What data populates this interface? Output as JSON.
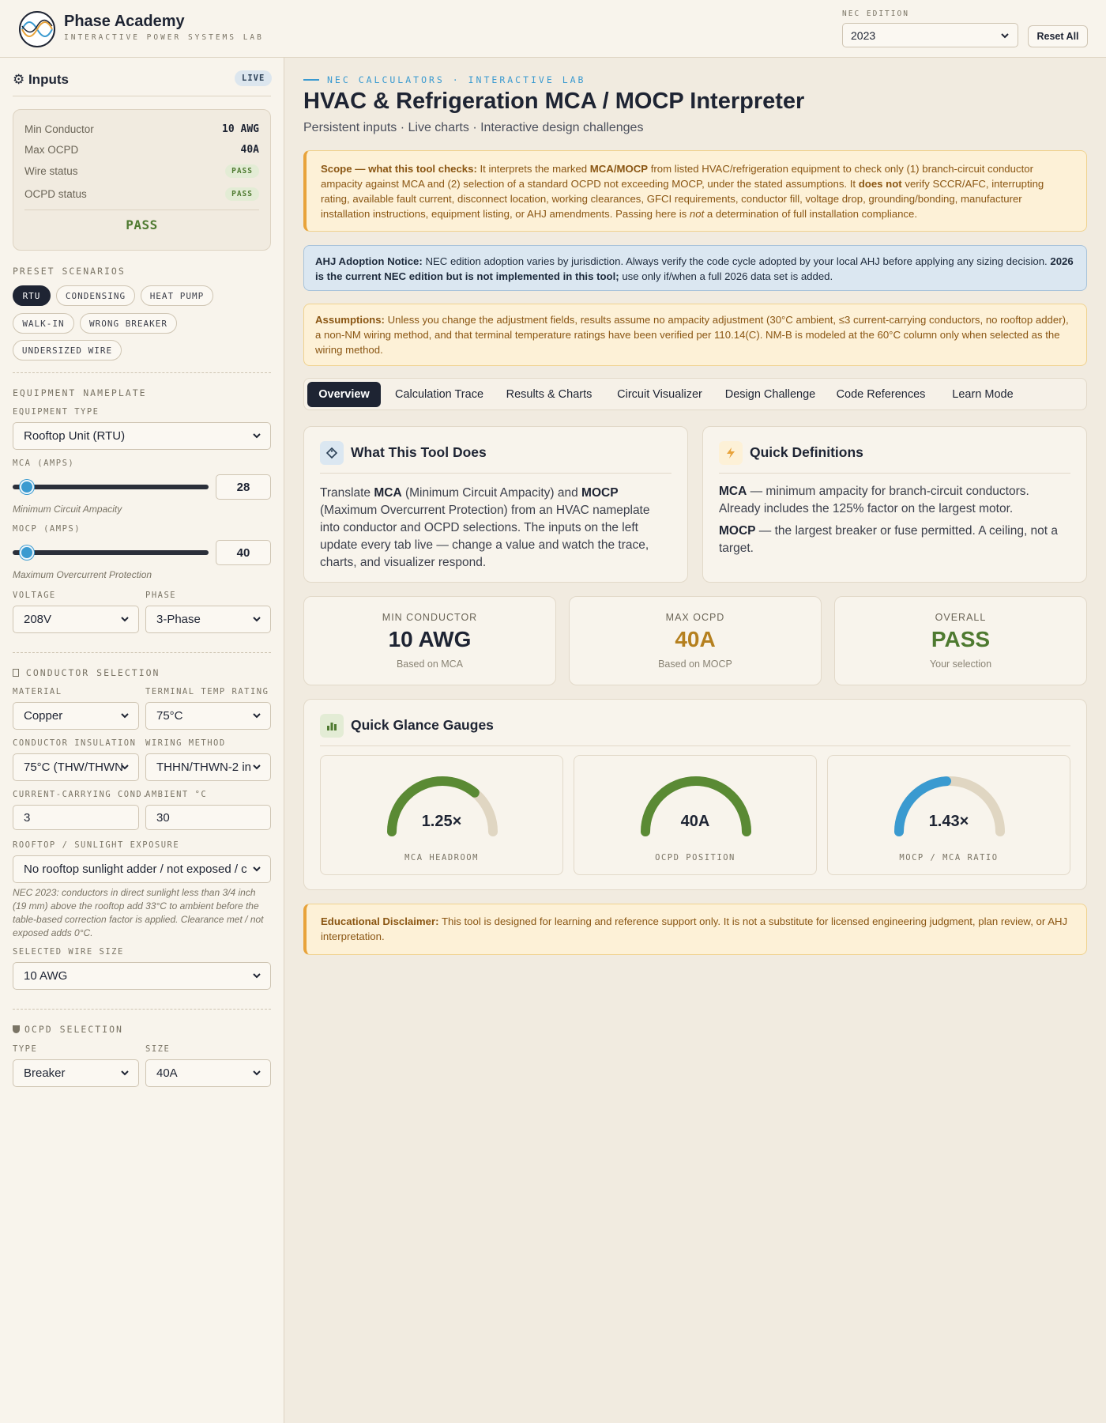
{
  "header": {
    "brand_title": "Phase Academy",
    "brand_subtitle": "INTERACTIVE POWER SYSTEMS LAB",
    "edition_label": "NEC EDITION",
    "edition_value": "2023",
    "reset_label": "Reset All"
  },
  "sidebar": {
    "title": "⚙ Inputs",
    "live_badge": "LIVE",
    "summary": {
      "min_conductor_label": "Min Conductor",
      "min_conductor_value": "10 AWG",
      "max_ocpd_label": "Max OCPD",
      "max_ocpd_value": "40A",
      "wire_status_label": "Wire status",
      "wire_status_value": "PASS",
      "ocpd_status_label": "OCPD status",
      "ocpd_status_value": "PASS",
      "overall": "PASS"
    },
    "presets_label": "PRESET SCENARIOS",
    "presets": [
      "RTU",
      "CONDENSING",
      "HEAT PUMP",
      "WALK-IN",
      "WRONG BREAKER",
      "UNDERSIZED WIRE"
    ],
    "nameplate": {
      "section_label": "EQUIPMENT NAMEPLATE",
      "equipment_type_label": "EQUIPMENT TYPE",
      "equipment_type_value": "Rooftop Unit (RTU)",
      "mca_label": "MCA (AMPS)",
      "mca_value": "28",
      "mca_slider_fraction": 0.04,
      "mca_hint": "Minimum Circuit Ampacity",
      "mocp_label": "MOCP (AMPS)",
      "mocp_value": "40",
      "mocp_slider_fraction": 0.04,
      "mocp_hint": "Maximum Overcurrent Protection",
      "voltage_label": "VOLTAGE",
      "voltage_value": "208V",
      "phase_label": "PHASE",
      "phase_value": "3-Phase"
    },
    "conductor": {
      "section_label": " CONDUCTOR SELECTION",
      "material_label": "MATERIAL",
      "material_value": "Copper",
      "terminal_label": "TERMINAL TEMP RATING",
      "terminal_value": "75°C",
      "insulation_label": "CONDUCTOR INSULATION",
      "insulation_value": "75°C (THW/THWN",
      "wiring_label": "WIRING METHOD",
      "wiring_value": "THHN/THWN-2 in",
      "ccc_label": "CURRENT-CARRYING COND.",
      "ccc_value": "3",
      "ambient_label": "AMBIENT °C",
      "ambient_value": "30",
      "rooftop_label": "ROOFTOP / SUNLIGHT EXPOSURE",
      "rooftop_value": "No rooftop sunlight adder / not exposed / c",
      "rooftop_hint": "NEC 2023: conductors in direct sunlight less than 3/4 inch (19 mm) above the rooftop add 33°C to ambient before the table-based correction factor is applied. Clearance met / not exposed adds 0°C.",
      "wire_size_label": "SELECTED WIRE SIZE",
      "wire_size_value": "10 AWG"
    },
    "ocpd": {
      "section_label": "OCPD SELECTION",
      "type_label": "TYPE",
      "type_value": "Breaker",
      "size_label": "SIZE",
      "size_value": "40A"
    }
  },
  "main": {
    "eyebrow": "NEC CALCULATORS · INTERACTIVE LAB",
    "title": "HVAC & Refrigeration MCA / MOCP Interpreter",
    "subtitle": "Persistent inputs · Live charts · Interactive design challenges",
    "scope": {
      "lead": "Scope — what this tool checks:",
      "t1": " It interprets the marked ",
      "b1": "MCA/MOCP",
      "t2": " from listed HVAC/refrigeration equipment to check only (1) branch-circuit conductor ampacity against MCA and (2) selection of a standard OCPD not exceeding MOCP, under the stated assumptions. It ",
      "b2": "does not",
      "t3": " verify SCCR/AFC, interrupting rating, available fault current, disconnect location, working clearances, GFCI requirements, conductor fill, voltage drop, grounding/bonding, manufacturer installation instructions, equipment listing, or AHJ amendments. Passing here is ",
      "i1": "not",
      "t4": " a determination of full installation compliance."
    },
    "ahj": {
      "lead": "AHJ Adoption Notice:",
      "t1": " NEC edition adoption varies by jurisdiction. Always verify the code cycle adopted by your local AHJ before applying any sizing decision. ",
      "b1": "2026 is the current NEC edition but is not implemented in this tool;",
      "t2": " use only if/when a full 2026 data set is added."
    },
    "assumptions": {
      "lead": "Assumptions:",
      "text": " Unless you change the adjustment fields, results assume no ampacity adjustment (30°C ambient, ≤3 current-carrying conductors, no rooftop adder), a non-NM wiring method, and that terminal temperature ratings have been verified per 110.14(C). NM-B is modeled at the 60°C column only when selected as the wiring method."
    },
    "tabs": [
      "Overview",
      "Calculation Trace",
      "Results & Charts",
      "Circuit Visualizer",
      "Design Challenge",
      "Code References",
      "Learn Mode"
    ],
    "what_card": {
      "title": "What This Tool Does",
      "t1": "Translate ",
      "b1": "MCA",
      "t2": " (Minimum Circuit Ampacity) and ",
      "b2": "MOCP",
      "t3": " (Maximum Overcurrent Protection) from an HVAC nameplate into conductor and OCPD selections. The inputs on the left update every tab live — change a value and watch the trace, charts, and visualizer respond."
    },
    "defs_card": {
      "title": "Quick Definitions",
      "mca_term": "MCA",
      "mca_def": " — minimum ampacity for branch-circuit conductors. Already includes the 125% factor on the largest motor.",
      "mocp_term": "MOCP",
      "mocp_def": " — the largest breaker or fuse permitted. A ceiling, not a target."
    },
    "stats": [
      {
        "label": "MIN CONDUCTOR",
        "value": "10 AWG",
        "sub": "Based on MCA"
      },
      {
        "label": "MAX OCPD",
        "value": "40A",
        "sub": "Based on MOCP"
      },
      {
        "label": "OVERALL",
        "value": "PASS",
        "sub": "Your selection"
      }
    ],
    "gauges_card": {
      "title": "Quick Glance Gauges",
      "gauges": [
        {
          "value": "1.25×",
          "label": "MCA HEADROOM",
          "fraction": 0.72,
          "color": "#5a8a34"
        },
        {
          "value": "40A",
          "label": "OCPD POSITION",
          "fraction": 1.0,
          "color": "#5a8a34"
        },
        {
          "value": "1.43×",
          "label": "MOCP / MCA RATIO",
          "fraction": 0.48,
          "color": "#3a9ad0"
        }
      ]
    },
    "disclaimer": {
      "lead": "Educational Disclaimer:",
      "text": " This tool is designed for learning and reference support only. It is not a substitute for licensed engineering judgment, plan review, or AHJ interpretation."
    }
  },
  "colors": {
    "navy": "#1e2433",
    "accent_blue": "#3a9ad0",
    "pass_green": "#4e7a30",
    "ocpd_gold": "#b5801f",
    "gauge_track": "#e0d6c2"
  }
}
